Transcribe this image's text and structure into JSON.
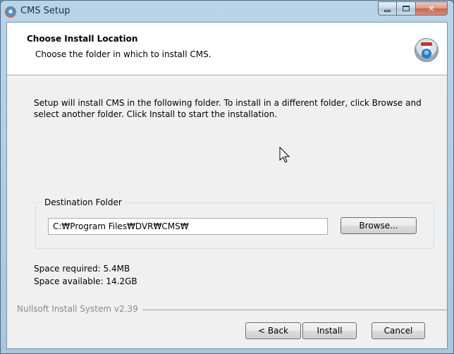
{
  "window": {
    "title": "CMS Setup",
    "icon": "setup-icon"
  },
  "header": {
    "title": "Choose Install Location",
    "subtitle": "Choose the folder in which to install CMS.",
    "icon": "installer-disk-icon"
  },
  "body": {
    "description": "Setup will install CMS in the following folder. To install in a different folder, click Browse and select another folder. Click Install to start the installation."
  },
  "destination": {
    "label": "Destination Folder",
    "path": "C:₩Program Files₩DVR₩CMS₩",
    "browse_label": "Browse..."
  },
  "space": {
    "required": "Space required: 5.4MB",
    "available": "Space available: 14.2GB"
  },
  "branding": "Nullsoft Install System v2.39",
  "buttons": {
    "back": "< Back",
    "install": "Install",
    "cancel": "Cancel"
  },
  "colors": {
    "titlebar": "#b9d3e8",
    "dialog_bg": "#f0f0f0",
    "header_bg": "#ffffff"
  }
}
